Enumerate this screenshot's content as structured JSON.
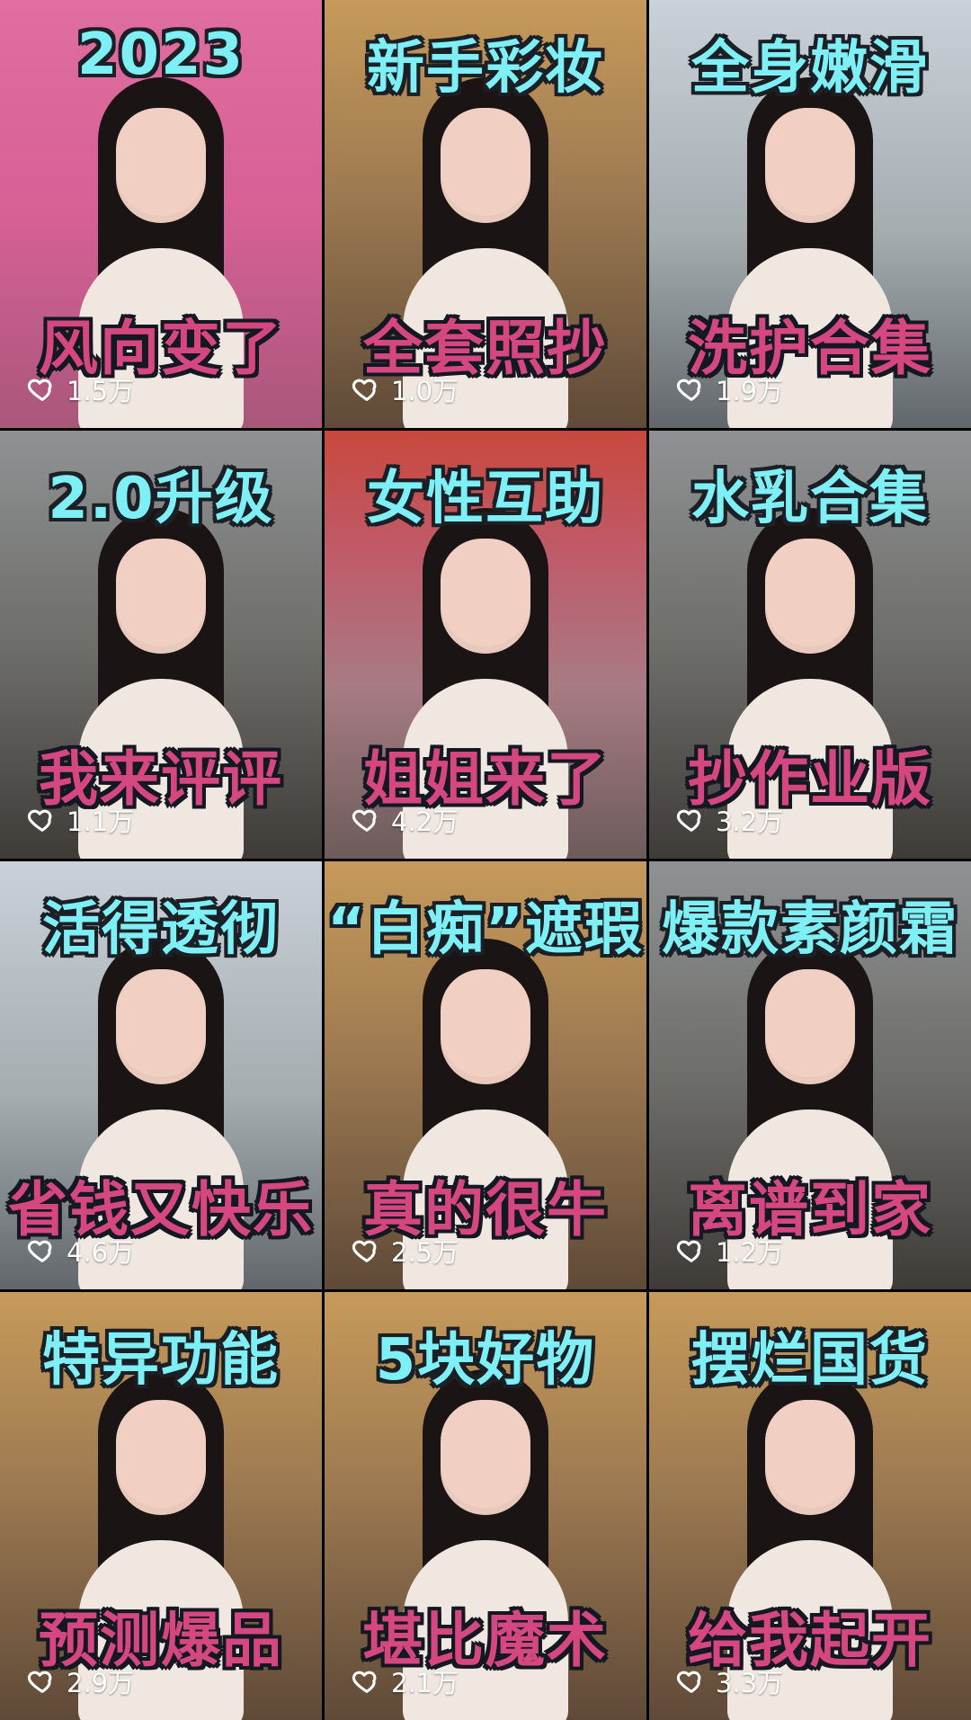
{
  "videos": [
    {
      "title_top": "2023",
      "title_bottom": "风向变了",
      "likes": "1.5万"
    },
    {
      "title_top": "新手彩妆",
      "title_bottom": "全套照抄",
      "likes": "1.0万"
    },
    {
      "title_top": "全身嫩滑",
      "title_bottom": "洗护合集",
      "likes": "1.9万"
    },
    {
      "title_top": "2.0升级",
      "title_bottom": "我来评评",
      "likes": "1.1万"
    },
    {
      "title_top": "女性互助",
      "title_bottom": "姐姐来了",
      "likes": "4.2万"
    },
    {
      "title_top": "水乳合集",
      "title_bottom": "抄作业版",
      "likes": "3.2万"
    },
    {
      "title_top": "活得透彻",
      "title_bottom": "省钱又快乐",
      "likes": "4.6万"
    },
    {
      "title_top": "“白痴”遮瑕",
      "title_bottom": "真的很牛",
      "likes": "2.5万"
    },
    {
      "title_top": "爆款素颜霜",
      "title_bottom": "离谱到家",
      "likes": "1.2万"
    },
    {
      "title_top": "特异功能",
      "title_bottom": "预测爆品",
      "likes": "2.9万"
    },
    {
      "title_top": "5块好物",
      "title_bottom": "堪比魔术",
      "likes": "2.1万"
    },
    {
      "title_top": "摆烂国货",
      "title_bottom": "给我起开",
      "likes": "3.3万"
    }
  ],
  "icons": {
    "like": "heart-outline-icon"
  }
}
